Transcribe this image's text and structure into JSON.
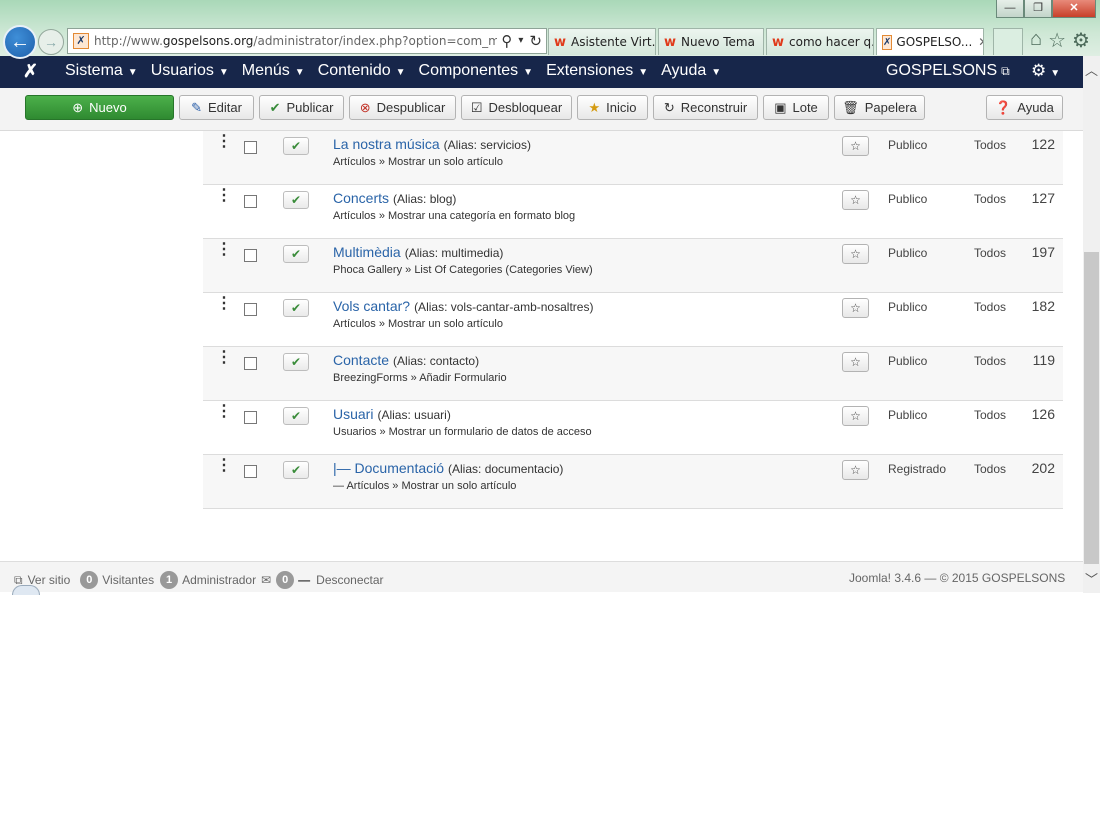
{
  "browser": {
    "url_prefix": "http://www.",
    "url_host": "gospelsons.org",
    "url_path": "/administrator/index.php?option=com_menu",
    "tabs": [
      {
        "label": "Asistente Virt...",
        "icon": "w-icon"
      },
      {
        "label": "Nuevo Tema",
        "icon": "w-icon"
      },
      {
        "label": "como hacer q...",
        "icon": "w-icon"
      },
      {
        "label": "GOSPELSO...",
        "icon": "joomla-icon",
        "active": true
      }
    ]
  },
  "navbar": {
    "menus": [
      "Sistema",
      "Usuarios",
      "Menús",
      "Contenido",
      "Componentes",
      "Extensiones",
      "Ayuda"
    ],
    "site_name": "GOSPELSONS"
  },
  "toolbar": {
    "new_label": "Nuevo",
    "edit_label": "Editar",
    "publish_label": "Publicar",
    "unpublish_label": "Despublicar",
    "checkin_label": "Desbloquear",
    "home_label": "Inicio",
    "rebuild_label": "Reconstruir",
    "batch_label": "Lote",
    "trash_label": "Papelera",
    "help_label": "Ayuda"
  },
  "rows": [
    {
      "title": "La nostra música",
      "alias": "(Alias: servicios)",
      "type": "Artículos » Mostrar un solo artículo",
      "access": "Publico",
      "language": "Todos",
      "id": "122"
    },
    {
      "title": "Concerts",
      "alias": "(Alias: blog)",
      "type": "Artículos » Mostrar una categoría en formato blog",
      "access": "Publico",
      "language": "Todos",
      "id": "127"
    },
    {
      "title": "Multimèdia",
      "alias": "(Alias: multimedia)",
      "type": "Phoca Gallery » List Of Categories (Categories View)",
      "access": "Publico",
      "language": "Todos",
      "id": "197"
    },
    {
      "title": "Vols cantar?",
      "alias": "(Alias: vols-cantar-amb-nosaltres)",
      "type": "Artículos » Mostrar un solo artículo",
      "access": "Publico",
      "language": "Todos",
      "id": "182"
    },
    {
      "title": "Contacte",
      "alias": "(Alias: contacto)",
      "type": "BreezingForms » Añadir Formulario",
      "access": "Publico",
      "language": "Todos",
      "id": "119"
    },
    {
      "title": "Usuari",
      "alias": "(Alias: usuari)",
      "type": "Usuarios » Mostrar un formulario de datos de acceso",
      "access": "Publico",
      "language": "Todos",
      "id": "126"
    },
    {
      "title": "|— Documentació",
      "alias": "(Alias: documentacio)",
      "type": "— Artículos » Mostrar un solo artículo",
      "access": "Registrado",
      "language": "Todos",
      "id": "202"
    }
  ],
  "status": {
    "view_site": "Ver sitio",
    "visitors_count": "0",
    "visitors_label": "Visitantes",
    "admin_count": "1",
    "admin_label": "Administrador",
    "messages_count": "0",
    "logout_label": "Desconectar",
    "version": "Joomla! 3.4.6 — © 2015 GOSPELSONS"
  }
}
